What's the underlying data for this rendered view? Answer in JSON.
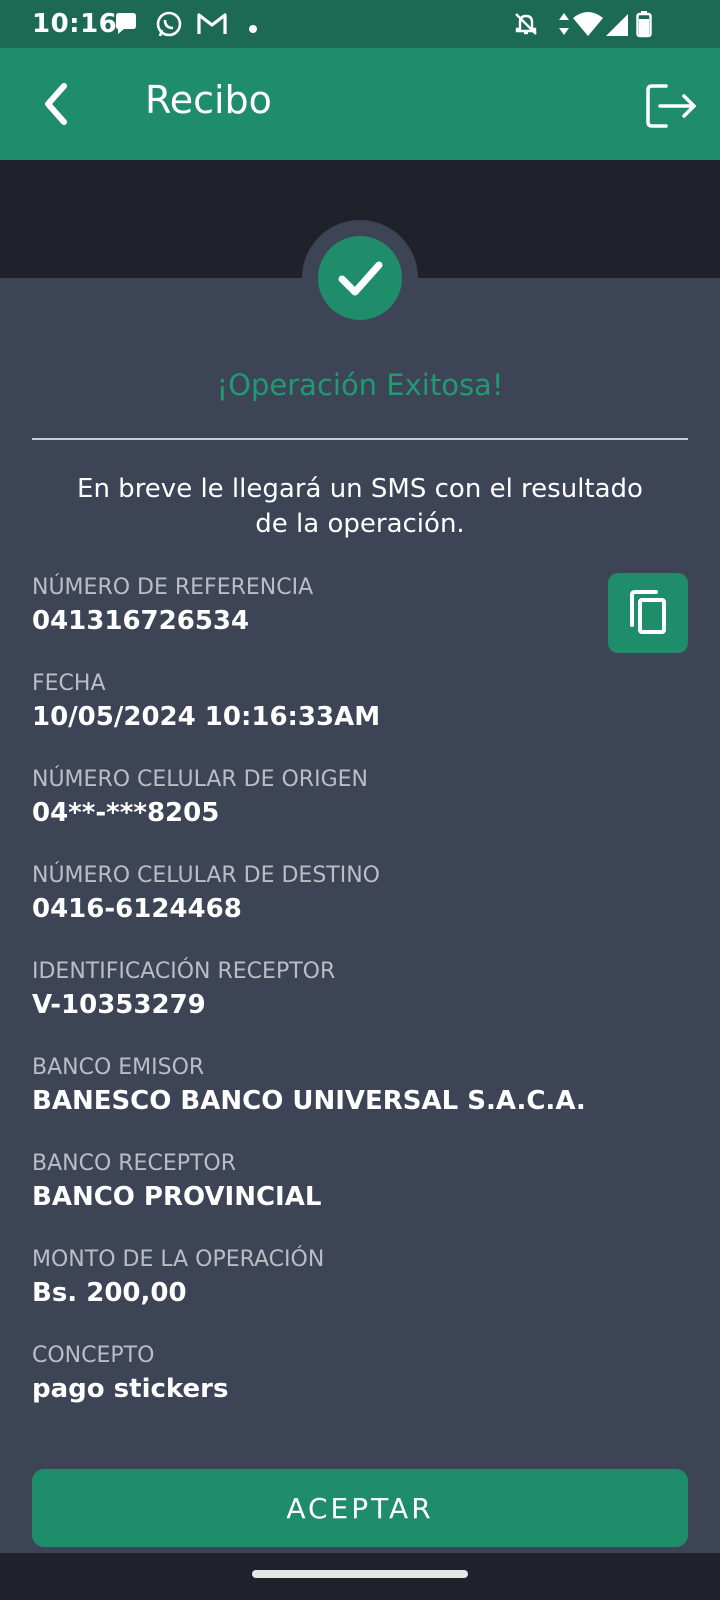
{
  "status_bar": {
    "time": "10:16",
    "notification_icons": [
      "chat-bubble-icon",
      "whatsapp-icon",
      "gmail-icon",
      "dot-icon"
    ],
    "system_icons": [
      "mute-bell-icon",
      "data-arrows-icon",
      "wifi-icon",
      "signal-icon",
      "battery-icon"
    ]
  },
  "app_bar": {
    "title": "Recibo",
    "back_icon": "chevron-left-icon",
    "logout_icon": "logout-icon"
  },
  "result": {
    "status_icon": "checkmark-icon",
    "title": "¡Operación Exitosa!",
    "message": "En breve le llegará un SMS con el resultado de la operación."
  },
  "fields": [
    {
      "label": "NÚMERO DE REFERENCIA",
      "value": "041316726534"
    },
    {
      "label": "FECHA",
      "value": "10/05/2024 10:16:33AM"
    },
    {
      "label": "NÚMERO CELULAR DE ORIGEN",
      "value": "04**-***8205"
    },
    {
      "label": "NÚMERO CELULAR DE DESTINO",
      "value": "0416-6124468"
    },
    {
      "label": "IDENTIFICACIÓN RECEPTOR",
      "value": "V-10353279"
    },
    {
      "label": "BANCO EMISOR",
      "value": "BANESCO BANCO UNIVERSAL S.A.C.A."
    },
    {
      "label": "BANCO RECEPTOR",
      "value": "BANCO PROVINCIAL"
    },
    {
      "label": "MONTO DE LA OPERACIÓN",
      "value": "Bs. 200,00"
    },
    {
      "label": "CONCEPTO",
      "value": "pago stickers"
    }
  ],
  "copy_icon": "copy-icon",
  "accept_button": "ACEPTAR",
  "colors": {
    "primary": "#1f8c6a",
    "status_bar": "#1c6a52",
    "background": "#3c4455",
    "dark_band": "#1f222b",
    "success_text": "#1f9a72",
    "label_text": "#b9bec6"
  }
}
